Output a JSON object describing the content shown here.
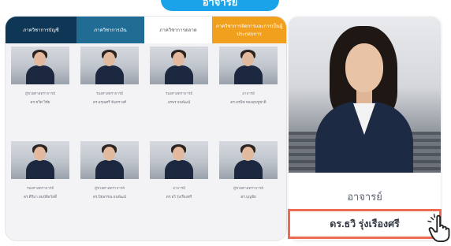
{
  "header": {
    "title": "อาจารย์"
  },
  "tabs": [
    {
      "label": "ภาควิชาการบัญชี"
    },
    {
      "label": "ภาควิชาการเงิน"
    },
    {
      "label": "ภาควิชาการตลาด"
    },
    {
      "label": "ภาควิชาการจัดการและการเป็นผู้ประกอบการ"
    }
  ],
  "faculty": [
    {
      "role": "ผู้ช่วยศาสตราจารย์",
      "name": "ดร.ชวิศ วิชัย"
    },
    {
      "role": "รองศาสตราจารย์",
      "name": "ดร.อรุณศรี จันทรวงศ์"
    },
    {
      "role": "รองศาสตราจารย์",
      "name": "อรพร ธนพัฒน์"
    },
    {
      "role": "อาจารย์",
      "name": "ดร.อรนิช ทองสุขชูชาติ"
    },
    {
      "role": "รองศาสตราจารย์",
      "name": "ดร.ศิริมา สมบัติสวัสดิ์"
    },
    {
      "role": "ผู้ช่วยศาสตราจารย์",
      "name": "ดร.ปิยพรรณ ธนพัฒน์"
    },
    {
      "role": "อาจารย์",
      "name": "ดร.ธวิ รุ่งเรืองศรี"
    },
    {
      "role": "ผู้ช่วยศาสตราจารย์",
      "name": "ดร.บุญชัย"
    }
  ],
  "profile": {
    "role": "อาจารย์",
    "name": "ดร.ธวิ รุ่งเรืองศรี"
  },
  "colors": {
    "accent_blue": "#1aa3e8",
    "tab_dark": "#0e3756",
    "tab_mid": "#216c94",
    "tab_orange": "#f1a01d",
    "highlight": "#ee6a55"
  }
}
